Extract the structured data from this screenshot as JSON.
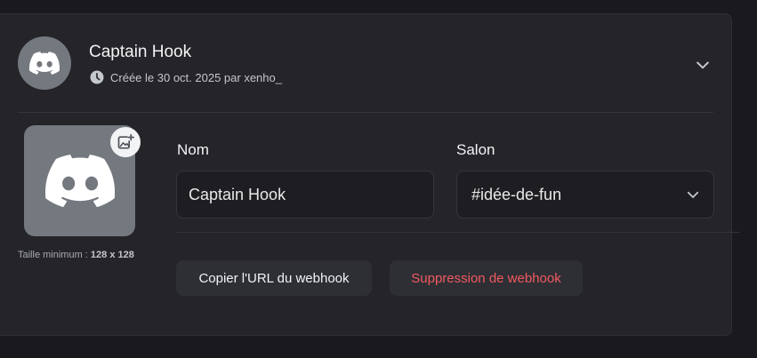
{
  "header": {
    "title": "Captain Hook",
    "meta": "Créée le 30 oct. 2025 par xenho_"
  },
  "avatar": {
    "size_hint_prefix": "Taille minimum : ",
    "size_hint_value": "128 x 128"
  },
  "form": {
    "name_label": "Nom",
    "name_value": "Captain Hook",
    "channel_label": "Salon",
    "channel_value": "#idée-de-fun"
  },
  "actions": {
    "copy_url_label": "Copier l'URL du webhook",
    "delete_label": "Suppression de webhook"
  },
  "colors": {
    "danger_text": "#f0595d",
    "avatar_bg": "#74787f",
    "card_bg": "#242429"
  },
  "icons": {
    "logo": "discord-logo-icon",
    "clock": "clock-icon",
    "chevron": "chevron-down-icon",
    "upload": "image-add-icon"
  }
}
